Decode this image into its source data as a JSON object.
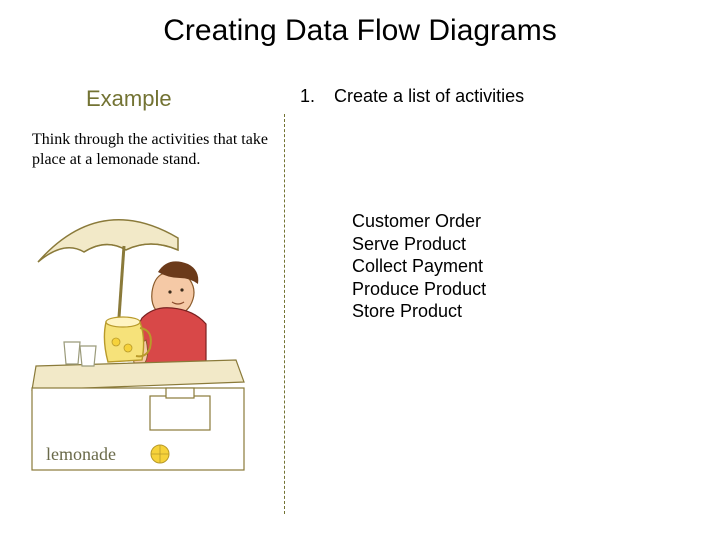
{
  "title": "Creating Data Flow Diagrams",
  "left": {
    "heading": "Example",
    "instruction": "Think through the activities that take place at a lemonade stand.",
    "illustration_label": "lemonade"
  },
  "right": {
    "step_number": "1.",
    "step_text": "Create a list of activities",
    "activities": [
      "Customer Order",
      "Serve Product",
      "Collect Payment",
      "Produce Product",
      "Store Product"
    ]
  }
}
